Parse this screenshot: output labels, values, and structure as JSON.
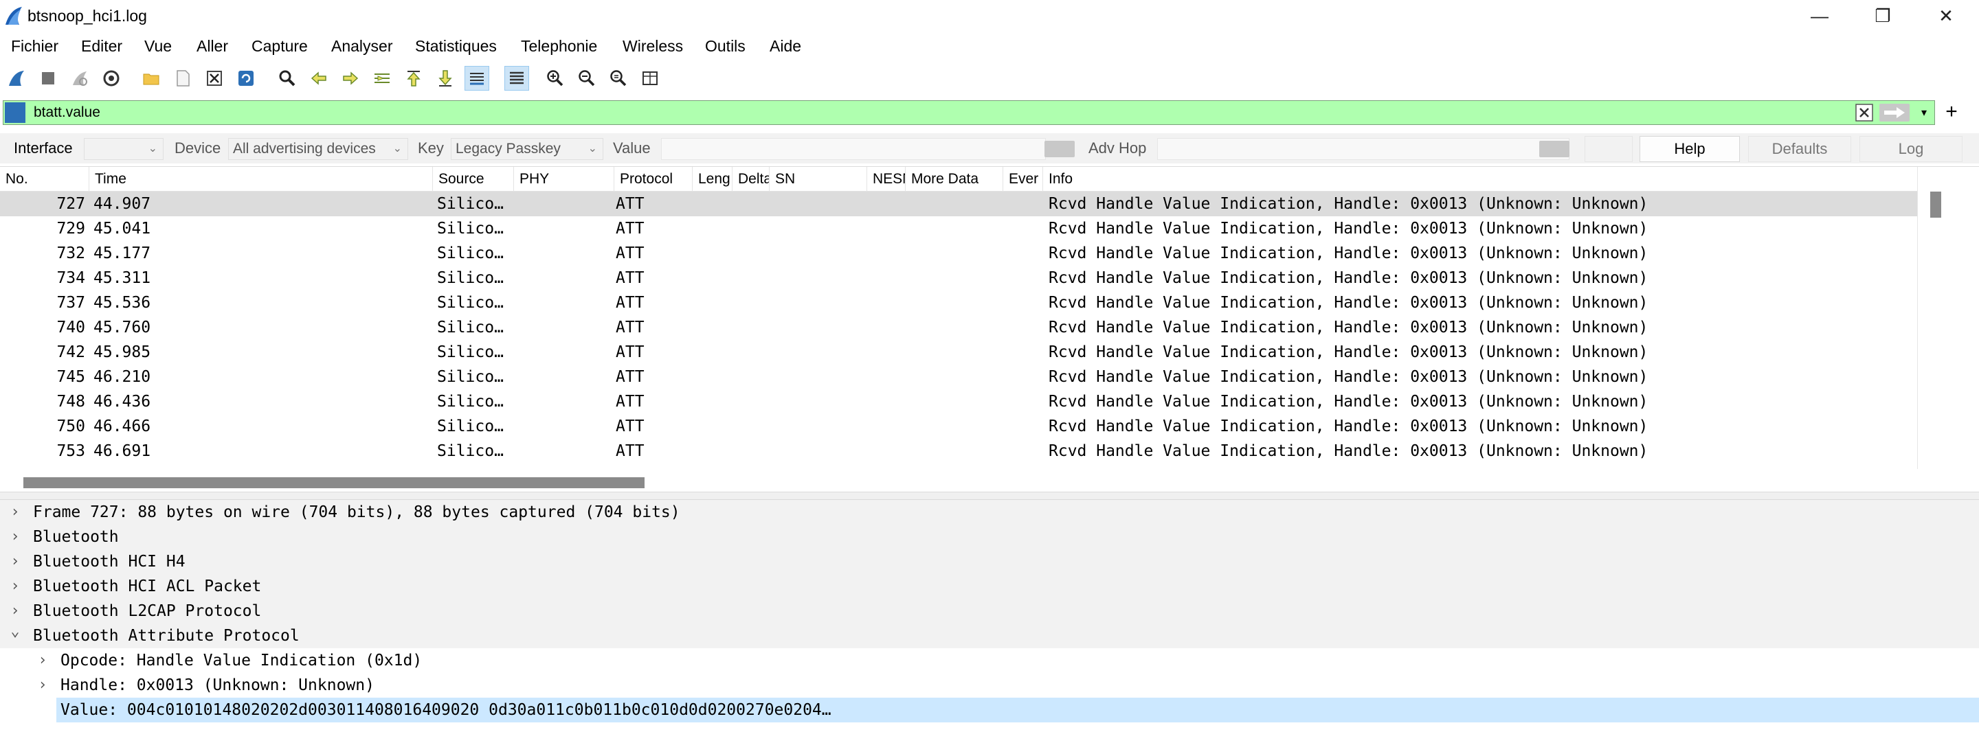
{
  "window": {
    "title": "btsnoop_hci1.log",
    "controls": {
      "minimize": "—",
      "maximize": "❐",
      "close": "✕"
    }
  },
  "menu": [
    "Fichier",
    "Editer",
    "Vue",
    "Aller",
    "Capture",
    "Analyser",
    "Statistiques",
    "Telephonie",
    "Wireless",
    "Outils",
    "Aide"
  ],
  "filter": {
    "value": "btatt.value",
    "plus": "+",
    "dropdown": "▾"
  },
  "interface_bar": {
    "interface_label": "Interface",
    "interface_value": "",
    "device_label": "Device",
    "device_value": "All advertising devices",
    "key_label": "Key",
    "key_value": "Legacy Passkey",
    "value_label": "Value",
    "advhop_label": "Adv Hop",
    "help": "Help",
    "defaults": "Defaults",
    "log": "Log"
  },
  "packet_list": {
    "columns": [
      "No.",
      "Time",
      "Source",
      "PHY",
      "Protocol",
      "Leng",
      "Delta",
      "SN",
      "NESN",
      "More Data",
      "Ever",
      "Info"
    ],
    "rows": [
      {
        "no": "727",
        "time": "44.907",
        "source": "Silico…",
        "protocol": "ATT",
        "info": "Rcvd Handle Value Indication, Handle: 0x0013 (Unknown: Unknown)"
      },
      {
        "no": "729",
        "time": "45.041",
        "source": "Silico…",
        "protocol": "ATT",
        "info": "Rcvd Handle Value Indication, Handle: 0x0013 (Unknown: Unknown)"
      },
      {
        "no": "732",
        "time": "45.177",
        "source": "Silico…",
        "protocol": "ATT",
        "info": "Rcvd Handle Value Indication, Handle: 0x0013 (Unknown: Unknown)"
      },
      {
        "no": "734",
        "time": "45.311",
        "source": "Silico…",
        "protocol": "ATT",
        "info": "Rcvd Handle Value Indication, Handle: 0x0013 (Unknown: Unknown)"
      },
      {
        "no": "737",
        "time": "45.536",
        "source": "Silico…",
        "protocol": "ATT",
        "info": "Rcvd Handle Value Indication, Handle: 0x0013 (Unknown: Unknown)"
      },
      {
        "no": "740",
        "time": "45.760",
        "source": "Silico…",
        "protocol": "ATT",
        "info": "Rcvd Handle Value Indication, Handle: 0x0013 (Unknown: Unknown)"
      },
      {
        "no": "742",
        "time": "45.985",
        "source": "Silico…",
        "protocol": "ATT",
        "info": "Rcvd Handle Value Indication, Handle: 0x0013 (Unknown: Unknown)"
      },
      {
        "no": "745",
        "time": "46.210",
        "source": "Silico…",
        "protocol": "ATT",
        "info": "Rcvd Handle Value Indication, Handle: 0x0013 (Unknown: Unknown)"
      },
      {
        "no": "748",
        "time": "46.436",
        "source": "Silico…",
        "protocol": "ATT",
        "info": "Rcvd Handle Value Indication, Handle: 0x0013 (Unknown: Unknown)"
      },
      {
        "no": "750",
        "time": "46.466",
        "source": "Silico…",
        "protocol": "ATT",
        "info": "Rcvd Handle Value Indication, Handle: 0x0013 (Unknown: Unknown)"
      },
      {
        "no": "753",
        "time": "46.691",
        "source": "Silico…",
        "protocol": "ATT",
        "info": "Rcvd Handle Value Indication, Handle: 0x0013 (Unknown: Unknown)"
      }
    ]
  },
  "details": [
    {
      "text": "Frame 727: 88 bytes on wire (704 bits), 88 bytes captured (704 bits)",
      "arrow": "›"
    },
    {
      "text": "Bluetooth",
      "arrow": "›"
    },
    {
      "text": "Bluetooth HCI H4",
      "arrow": "›"
    },
    {
      "text": "Bluetooth HCI ACL Packet",
      "arrow": "›"
    },
    {
      "text": "Bluetooth L2CAP Protocol",
      "arrow": "›"
    },
    {
      "text": "Bluetooth Attribute Protocol",
      "arrow": "⌄"
    },
    {
      "text": "Opcode: Handle Value Indication (0x1d)",
      "arrow": "›"
    },
    {
      "text": "Handle: 0x0013 (Unknown: Unknown)",
      "arrow": "›"
    },
    {
      "text": "Value: 004c01010148020202d003011408016409020 0d30a011c0b011b0c010d0d0200270e0204…",
      "arrow": ""
    }
  ],
  "colors": {
    "filter_bg": "#afffaf",
    "selected_row": "#dcdcdc",
    "selected_detail": "#cce8ff",
    "accent": "#2c6fb6"
  }
}
